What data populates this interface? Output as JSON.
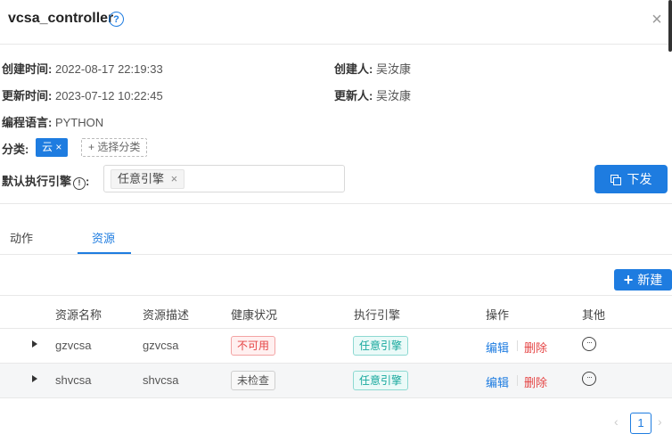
{
  "header": {
    "title": "vcsa_controller",
    "help_glyph": "?",
    "close_glyph": "×"
  },
  "info": {
    "created_time_label": "创建时间:",
    "created_time_value": "2022-08-17 22:19:33",
    "creator_label": "创建人:",
    "creator_value": "吴汝康",
    "updated_time_label": "更新时间:",
    "updated_time_value": "2023-07-12 10:22:45",
    "updater_label": "更新人:",
    "updater_value": "吴汝康",
    "language_label": "编程语言:",
    "language_value": "PYTHON",
    "category_label": "分类:",
    "category_tag": "云 ×",
    "category_select": "+ 选择分类",
    "engine_label": "默认执行引擎",
    "engine_chip": "任意引擎",
    "engine_chip_close": "×"
  },
  "actions": {
    "deploy_label": "下发",
    "new_label": "新建"
  },
  "tabs": [
    {
      "label": "动作"
    },
    {
      "label": "资源"
    }
  ],
  "active_tab": "资源",
  "table": {
    "headers": [
      "资源名称",
      "资源描述",
      "健康状况",
      "执行引擎",
      "操作",
      "其他"
    ],
    "rows": [
      {
        "name": "gzvcsa",
        "desc": "gzvcsa",
        "health": "不可用",
        "health_status": "unavailable",
        "engine": "任意引擎",
        "edit": "编辑",
        "delete": "删除",
        "more_glyph": "···"
      },
      {
        "name": "shvcsa",
        "desc": "shvcsa",
        "health": "未检查",
        "health_status": "unchecked",
        "engine": "任意引擎",
        "edit": "编辑",
        "delete": "删除",
        "more_glyph": "···"
      }
    ]
  },
  "pagination": {
    "current_page": "1",
    "prev_glyph": "‹",
    "next_glyph": "›"
  },
  "colors": {
    "primary": "#1e7ce0",
    "danger": "#e54545",
    "teal": "#17a89d"
  }
}
